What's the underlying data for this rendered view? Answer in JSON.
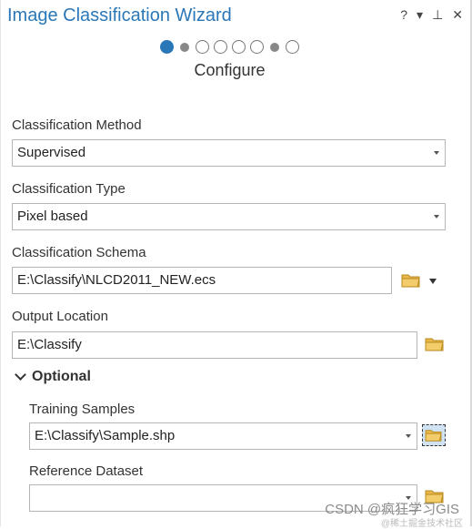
{
  "window": {
    "title": "Image Classification Wizard",
    "help": "?",
    "menu": "▾",
    "pin": "⊥",
    "close": "✕"
  },
  "steps": {
    "current": 1,
    "total": 8,
    "title": "Configure"
  },
  "classification_method": {
    "label": "Classification Method",
    "value": "Supervised"
  },
  "classification_type": {
    "label": "Classification Type",
    "value": "Pixel based"
  },
  "classification_schema": {
    "label": "Classification Schema",
    "value": "E:\\Classify\\NLCD2011_NEW.ecs"
  },
  "output_location": {
    "label": "Output Location",
    "value": "E:\\Classify"
  },
  "optional": {
    "label": "Optional",
    "training_samples": {
      "label": "Training Samples",
      "value": "E:\\Classify\\Sample.shp"
    },
    "reference_dataset": {
      "label": "Reference Dataset",
      "value": ""
    }
  },
  "watermark": {
    "text": "CSDN @疯狂学习GIS",
    "sub": "@稀土掘金技术社区"
  },
  "colors": {
    "accent": "#2a77b8",
    "folder": "#e8b84a"
  }
}
